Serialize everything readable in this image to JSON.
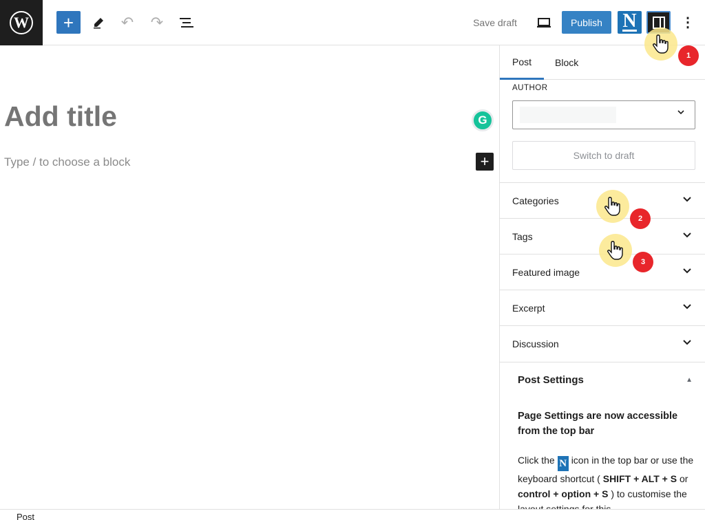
{
  "topbar": {
    "add_label": "+",
    "save_draft": "Save draft",
    "publish": "Publish",
    "n_logo": "N",
    "more": "⋮"
  },
  "editor": {
    "title_placeholder": "Add title",
    "block_placeholder": "Type / to choose a block",
    "grammarly": "G",
    "inserter": "+"
  },
  "sidebar": {
    "tabs": [
      {
        "label": "Post"
      },
      {
        "label": "Block"
      }
    ],
    "author_label": "AUTHOR",
    "switch_to_draft": "Switch to draft",
    "panels": [
      {
        "label": "Categories"
      },
      {
        "label": "Tags"
      },
      {
        "label": "Featured image"
      },
      {
        "label": "Excerpt"
      },
      {
        "label": "Discussion"
      }
    ],
    "post_settings": {
      "title": "Post Settings",
      "heading": "Page Settings are now accessible from the top bar",
      "body_1": "Click the",
      "body_2": "icon in the top bar or use the keyboard shortcut (",
      "shortcut_1": "SHIFT + ALT + S",
      "body_3": "or",
      "shortcut_2": "control + option + S",
      "body_4": ") to customise the layout settings for this"
    }
  },
  "markers": [
    {
      "label": "1"
    },
    {
      "label": "2"
    },
    {
      "label": "3"
    }
  ],
  "footer": {
    "breadcrumb": "Post"
  },
  "colors": {
    "accent": "#2f76bd",
    "publish": "#3582c4",
    "badge": "#e8262b",
    "highlight": "#fce88c"
  }
}
